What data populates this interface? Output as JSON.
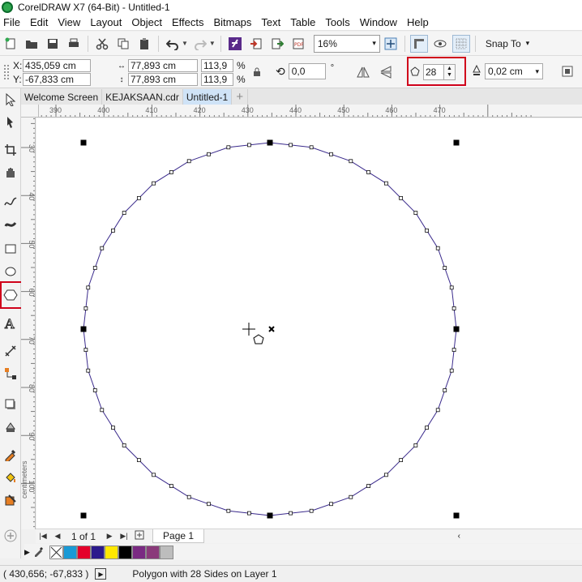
{
  "window": {
    "title": "CorelDRAW X7 (64-Bit) - Untitled-1"
  },
  "menu": [
    "File",
    "Edit",
    "View",
    "Layout",
    "Object",
    "Effects",
    "Bitmaps",
    "Text",
    "Table",
    "Tools",
    "Window",
    "Help"
  ],
  "standard_toolbar": {
    "zoom_level": "16%",
    "snap_label": "Snap To"
  },
  "property_bar": {
    "x_label": "X:",
    "x_value": "435,059 cm",
    "y_label": "Y:",
    "y_value": "-67,833 cm",
    "width_value": "77,893 cm",
    "height_value": "77,893 cm",
    "scale_x": "113,9",
    "scale_y": "113,9",
    "percent_sign": "%",
    "rotation": "0,0",
    "degree_sign": "°",
    "polygon_sides": "28",
    "outline_width": "0,02 cm"
  },
  "document_tabs": [
    "Welcome Screen",
    "KEJAKSAAN.cdr",
    "Untitled-1"
  ],
  "active_tab_index": 2,
  "ruler": {
    "horizontal_ticks": [
      "390",
      "400",
      "410",
      "420",
      "430",
      "440",
      "450",
      "460",
      "470"
    ],
    "vertical_ticks": [
      "30",
      "40",
      "50",
      "60",
      "70",
      "80",
      "90",
      "100"
    ],
    "vertical_unit": "centimeters"
  },
  "polygon": {
    "sides": 28,
    "shape": "polygon",
    "selected": true,
    "outline_color": "#3a2a8c"
  },
  "page_navigator": {
    "page_counter": "1 of 1",
    "page_tab": "Page 1"
  },
  "palette_colors": [
    "none",
    "#1a9ad6",
    "#e4002b",
    "#2b1a8c",
    "#ffe800",
    "#000000",
    "#7a2a82",
    "#8a3a7a",
    "#bdbdbd"
  ],
  "status_bar": {
    "cursor_position": "( 430,656; -67,833 )",
    "message": "Polygon with 28 Sides on Layer 1"
  }
}
